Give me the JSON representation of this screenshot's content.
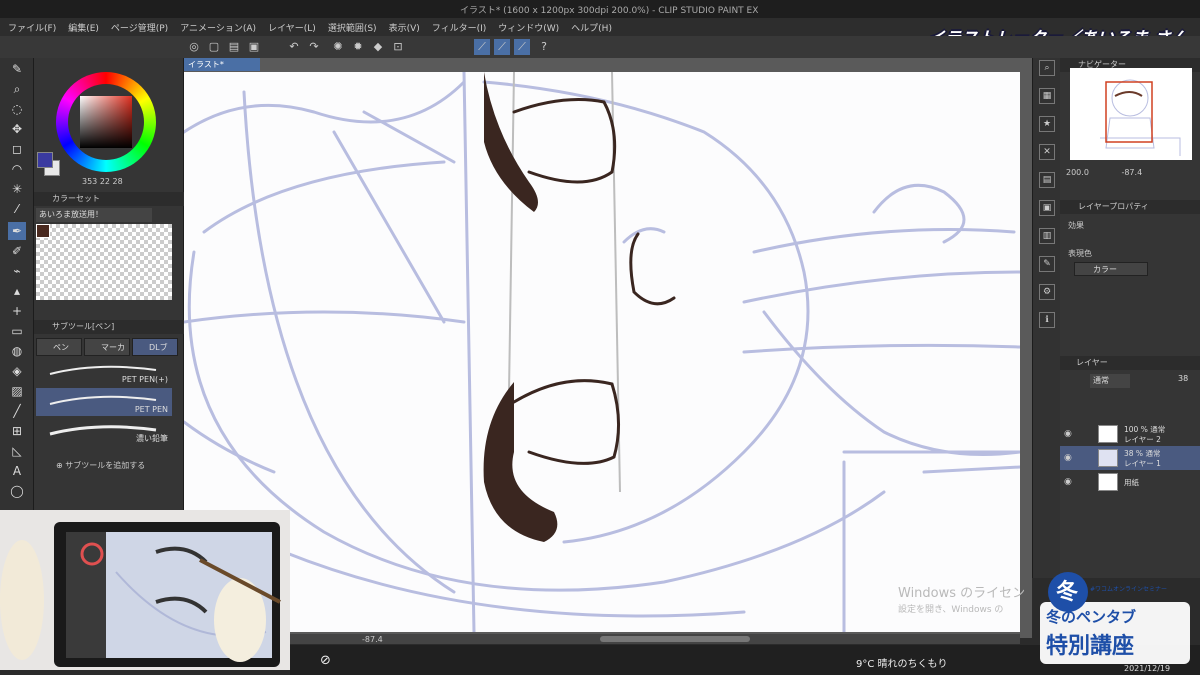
{
  "window": {
    "title": "イラスト* (1600 x 1200px 300dpi 200.0%)  - CLIP STUDIO PAINT EX"
  },
  "menu": [
    "ファイル(F)",
    "編集(E)",
    "ページ管理(P)",
    "アニメーション(A)",
    "レイヤー(L)",
    "選択範囲(S)",
    "表示(V)",
    "フィルター(I)",
    "ウィンドウ(W)",
    "ヘルプ(H)"
  ],
  "overlay": {
    "streamer": "イラストレーター／あいろま さん"
  },
  "color_panel": {
    "values": "353  22  28"
  },
  "color_set": {
    "header": "カラーセット",
    "dropdown": "あいろま放送用！"
  },
  "sub_tool": {
    "header": "サブツール[ペン]",
    "tabs": [
      "ペン",
      "マーカ",
      "DLブ"
    ],
    "brushes": [
      {
        "label": "PET PEN(+)"
      },
      {
        "label": "PET PEN"
      },
      {
        "label": "濃い鉛筆"
      }
    ],
    "add_label": "サブツールを追加する"
  },
  "document": {
    "tab": "イラスト*"
  },
  "canvas_status": {
    "angle": "-87.4"
  },
  "navigator": {
    "header": "ナビゲーター",
    "zoom": "200.0",
    "angle": "-87.4"
  },
  "layer_property": {
    "header": "レイヤープロパティ",
    "effect_label": "効果",
    "expression_label": "表現色",
    "expression_value": "カラー"
  },
  "layer_panel": {
    "header": "レイヤー",
    "blend": "通常",
    "opacity": "38",
    "layers": [
      {
        "line1": "100 % 通常",
        "line2": "レイヤー 2",
        "selected": false
      },
      {
        "line1": "38 % 通常",
        "line2": "レイヤー 1",
        "selected": true
      },
      {
        "line1": "",
        "line2": "用紙",
        "selected": false
      }
    ]
  },
  "watermark": {
    "line1": "Windows のライセン",
    "line2": "設定を開き、Windows の"
  },
  "taskbar": {
    "weather": "9°C  晴れのちくもり",
    "date": "2021/12/19"
  },
  "event_logo": {
    "top": "#ワコムオンラインセミナー",
    "line1": "冬のペンタブ",
    "line2": "特別講座"
  },
  "colors": {
    "accent": "#4a6fa5",
    "selected_row": "#4a5a80",
    "sketch_blue": "#b8bde0",
    "ink_brown": "#3a2620"
  }
}
